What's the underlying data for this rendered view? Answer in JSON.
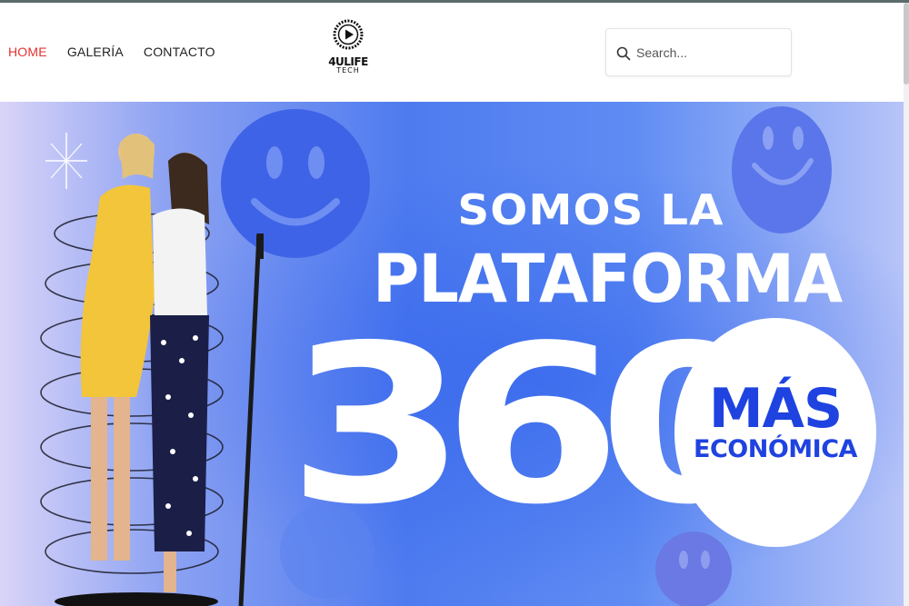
{
  "nav": {
    "items": [
      {
        "label": "HOME",
        "active": true
      },
      {
        "label": "GALERÍA",
        "active": false
      },
      {
        "label": "CONTACTO",
        "active": false
      }
    ],
    "active_color": "#e0322f"
  },
  "logo": {
    "name": "4ULIFE",
    "sub": "TECH",
    "icon": "play-circle-icon"
  },
  "search": {
    "placeholder": "Search...",
    "icon": "search-icon"
  },
  "hero": {
    "line1": "SOMOS LA",
    "line2": "PLATAFORMA",
    "number": "360",
    "badge_line1": "MÁS",
    "badge_line2": "ECONÓMICA",
    "accent_color": "#1f43e0"
  }
}
